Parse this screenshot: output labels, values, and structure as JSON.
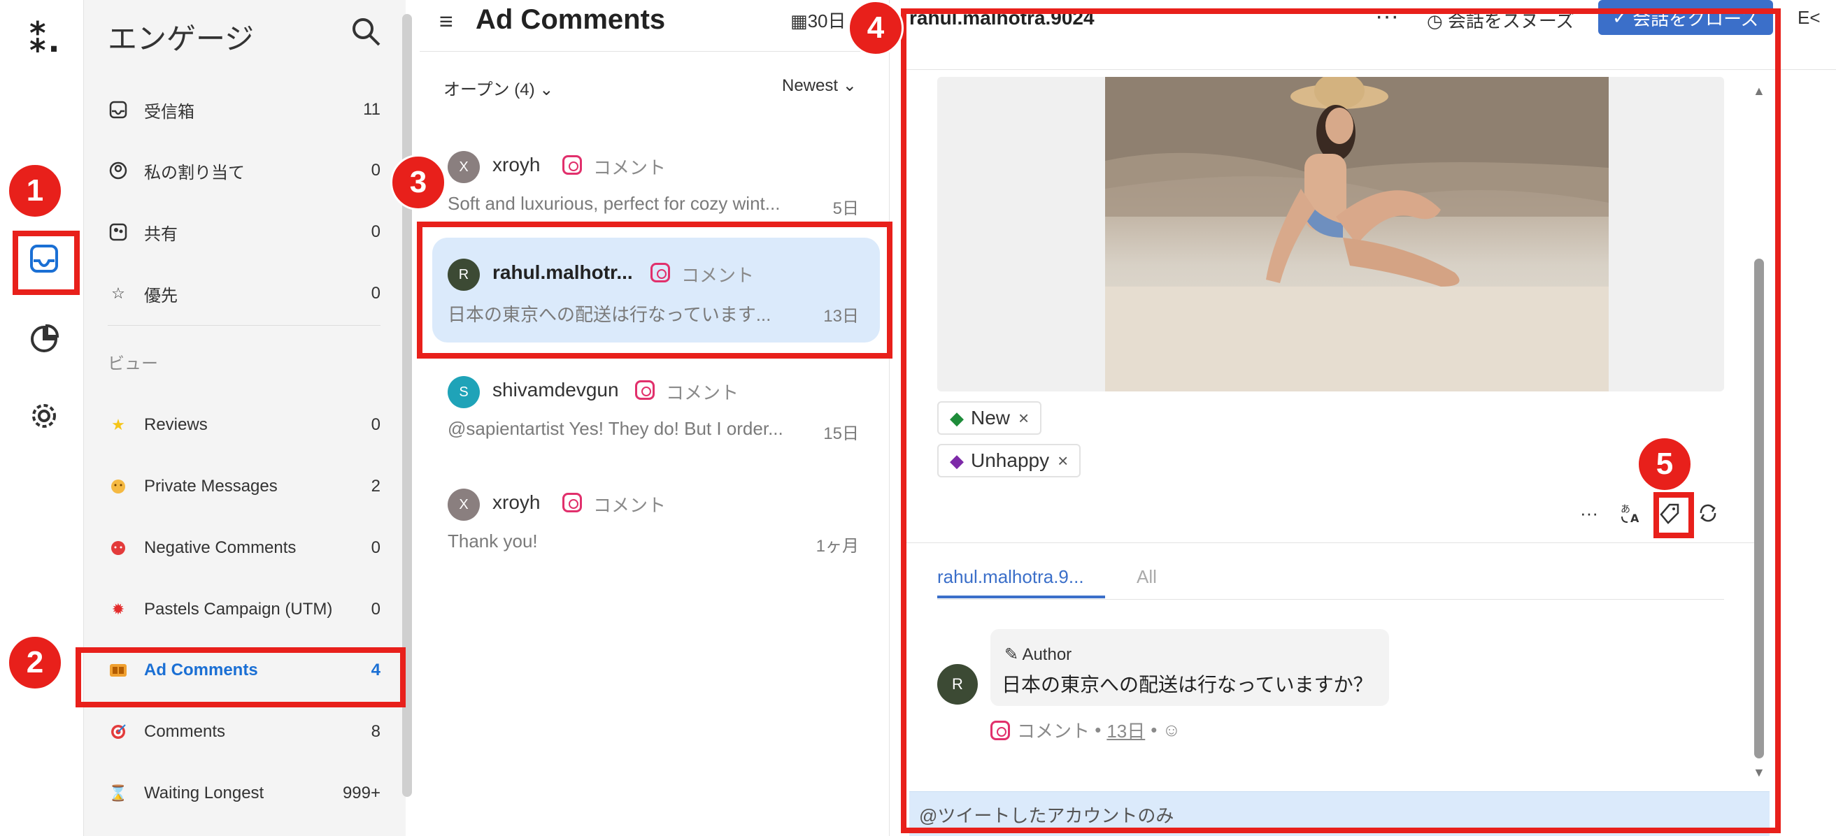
{
  "app": {
    "logo": "⁑.",
    "title": "エンゲージ"
  },
  "sidebar": {
    "items": [
      {
        "label": "受信箱",
        "count": "11",
        "icon": "inbox-icon"
      },
      {
        "label": "私の割り当て",
        "count": "0",
        "icon": "user-circle-icon"
      },
      {
        "label": "共有",
        "count": "0",
        "icon": "shared-icon"
      },
      {
        "label": "優先",
        "count": "0",
        "icon": "star-icon"
      }
    ],
    "views_label": "ビュー",
    "views": [
      {
        "label": "Reviews",
        "count": "0",
        "icon": "star-emoji-icon"
      },
      {
        "label": "Private Messages",
        "count": "2",
        "icon": "face-emoji-icon"
      },
      {
        "label": "Negative Comments",
        "count": "0",
        "icon": "angry-emoji-icon"
      },
      {
        "label": "Pastels Campaign (UTM)",
        "count": "0",
        "icon": "maple-leaf-icon"
      },
      {
        "label": "Ad Comments",
        "count": "4",
        "icon": "ad-emoji-icon"
      },
      {
        "label": "Comments",
        "count": "8",
        "icon": "target-emoji-icon"
      },
      {
        "label": "Waiting Longest",
        "count": "999+",
        "icon": "hourglass-icon"
      }
    ]
  },
  "list": {
    "title": "Ad Comments",
    "date_filter": "30日",
    "status_filter": "オープン (4)",
    "sort": "Newest",
    "conversations": [
      {
        "avatar": "X",
        "avatar_color": "#8a7f7f",
        "name": "xroyh",
        "type": "コメント",
        "preview": "Soft and luxurious, perfect for cozy wint...",
        "age": "5日"
      },
      {
        "avatar": "R",
        "avatar_color": "#3c4a34",
        "name": "rahul.malhotr...",
        "type": "コメント",
        "preview": "日本の東京への配送は行なっています...",
        "age": "13日"
      },
      {
        "avatar": "S",
        "avatar_color": "#1fa3b8",
        "name": "shivamdevgun",
        "type": "コメント",
        "preview": "@sapientartist Yes! They do! But I order...",
        "age": "15日"
      },
      {
        "avatar": "X",
        "avatar_color": "#8a7f7f",
        "name": "xroyh",
        "type": "コメント",
        "preview": "Thank you!",
        "age": "1ヶ月"
      }
    ]
  },
  "detail": {
    "username": "rahul.malhotra.9024",
    "snooze_label": "会話をスヌーズ",
    "close_label": "会話をクローズ",
    "extra": "E<",
    "tags": [
      {
        "label": "New",
        "color": "#1e8c3a"
      },
      {
        "label": "Unhappy",
        "color": "#7d2aa8"
      }
    ],
    "tab_user": "rahul.malhotra.9...",
    "tab_all": "All",
    "message": {
      "avatar": "R",
      "author": "Author",
      "text": "日本の東京への配送は行なっていますか？",
      "type": "コメント",
      "age": "13日"
    },
    "reply_hint": "@ツイートしたアカウントのみ"
  },
  "annotations": [
    "1",
    "2",
    "3",
    "4",
    "5"
  ],
  "colors": {
    "accent": "#3b6fc9",
    "annotation": "#e8201b",
    "active_bg": "#dbeafb"
  }
}
